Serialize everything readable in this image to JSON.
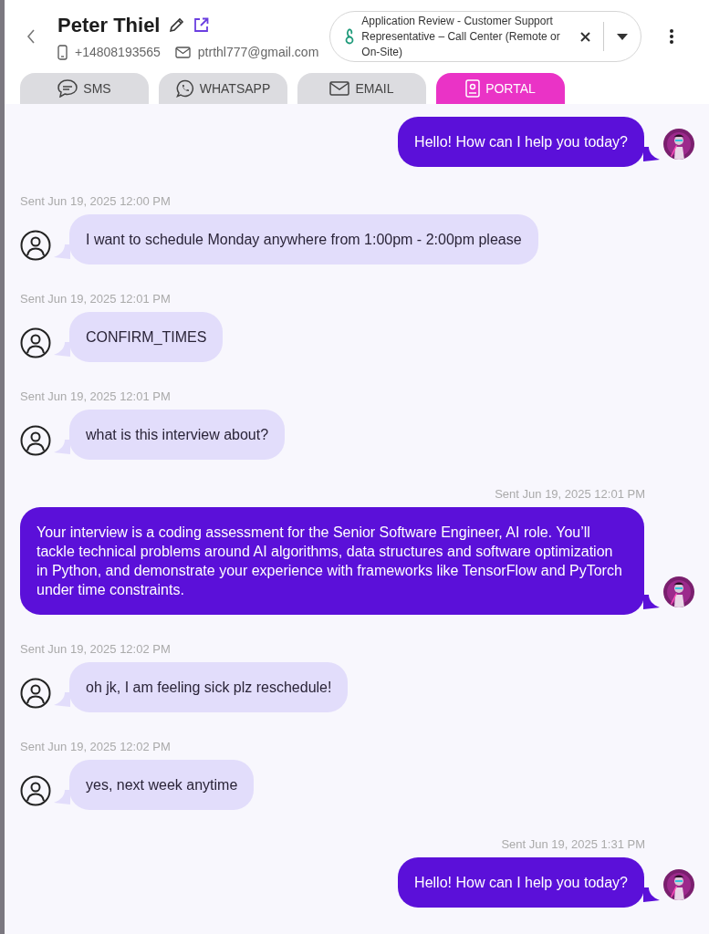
{
  "contact": {
    "name": "Peter Thiel",
    "phone": "+14808193565",
    "email": "ptrthl777@gmail.com"
  },
  "job": {
    "title": "Application Review - Customer Support Representative – Call Center (Remote or On-Site)"
  },
  "tabs": [
    {
      "label": "SMS",
      "selected": false
    },
    {
      "label": "WHATSAPP",
      "selected": false
    },
    {
      "label": "EMAIL",
      "selected": false
    },
    {
      "label": "PORTAL",
      "selected": true
    }
  ],
  "messages": [
    {
      "kind": "outgoing",
      "text": "Hello! How can I help you today?"
    },
    {
      "kind": "incoming",
      "timestamp": "Sent Jun 19, 2025 12:00 PM",
      "text": "I want to schedule Monday anywhere from 1:00pm - 2:00pm please"
    },
    {
      "kind": "incoming",
      "timestamp": "Sent Jun 19, 2025 12:01 PM",
      "text": "CONFIRM_TIMES"
    },
    {
      "kind": "incoming",
      "timestamp": "Sent Jun 19, 2025 12:01 PM",
      "text": "what is this interview about?"
    },
    {
      "kind": "outgoing",
      "timestamp": "Sent Jun 19, 2025 12:01 PM",
      "text": "Your interview is a coding assessment for the Senior Software Engineer, AI role. You’ll tackle technical problems around AI algorithms, data structures and software optimization in Python, and demonstrate your experience with frameworks like TensorFlow and PyTorch under time constraints."
    },
    {
      "kind": "incoming",
      "timestamp": "Sent Jun 19, 2025 12:02 PM",
      "text": "oh jk, I am feeling sick plz reschedule!"
    },
    {
      "kind": "incoming",
      "timestamp": "Sent Jun 19, 2025 12:02 PM",
      "text": "yes, next week anytime"
    },
    {
      "kind": "outgoing",
      "timestamp": "Sent Jun 19, 2025 1:31 PM",
      "text": "Hello! How can I help you today?"
    }
  ]
}
